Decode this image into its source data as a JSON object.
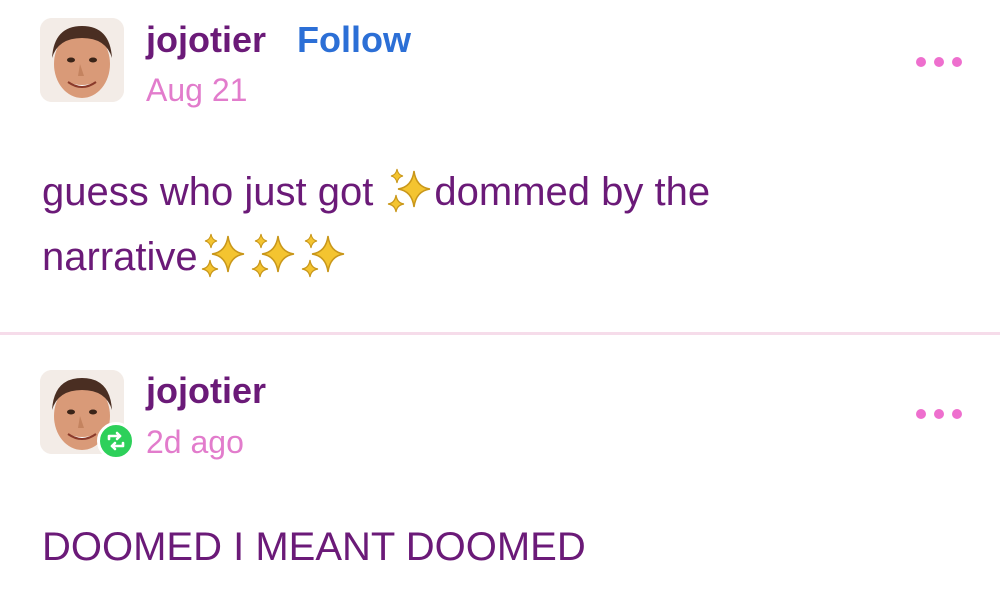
{
  "posts": [
    {
      "username": "jojotier",
      "follow_label": "Follow",
      "timestamp": "Aug 21",
      "body_line_1_before": "guess who just got ",
      "body_line_1_after": "dommed by the",
      "body_line_2": "narrative",
      "more_icon": "more-options-icon"
    },
    {
      "username": "jojotier",
      "timestamp": "2d ago",
      "badge_icon": "reblog-icon",
      "body": "DOOMED I MEANT DOOMED",
      "more_icon": "more-options-icon"
    }
  ],
  "colors": {
    "username": "#6b1a78",
    "follow": "#2c6fd6",
    "timestamp": "#e27ccc",
    "more_dots": "#ee6fce",
    "reblog_badge": "#2dd05a",
    "divider": "#f6dcea"
  }
}
